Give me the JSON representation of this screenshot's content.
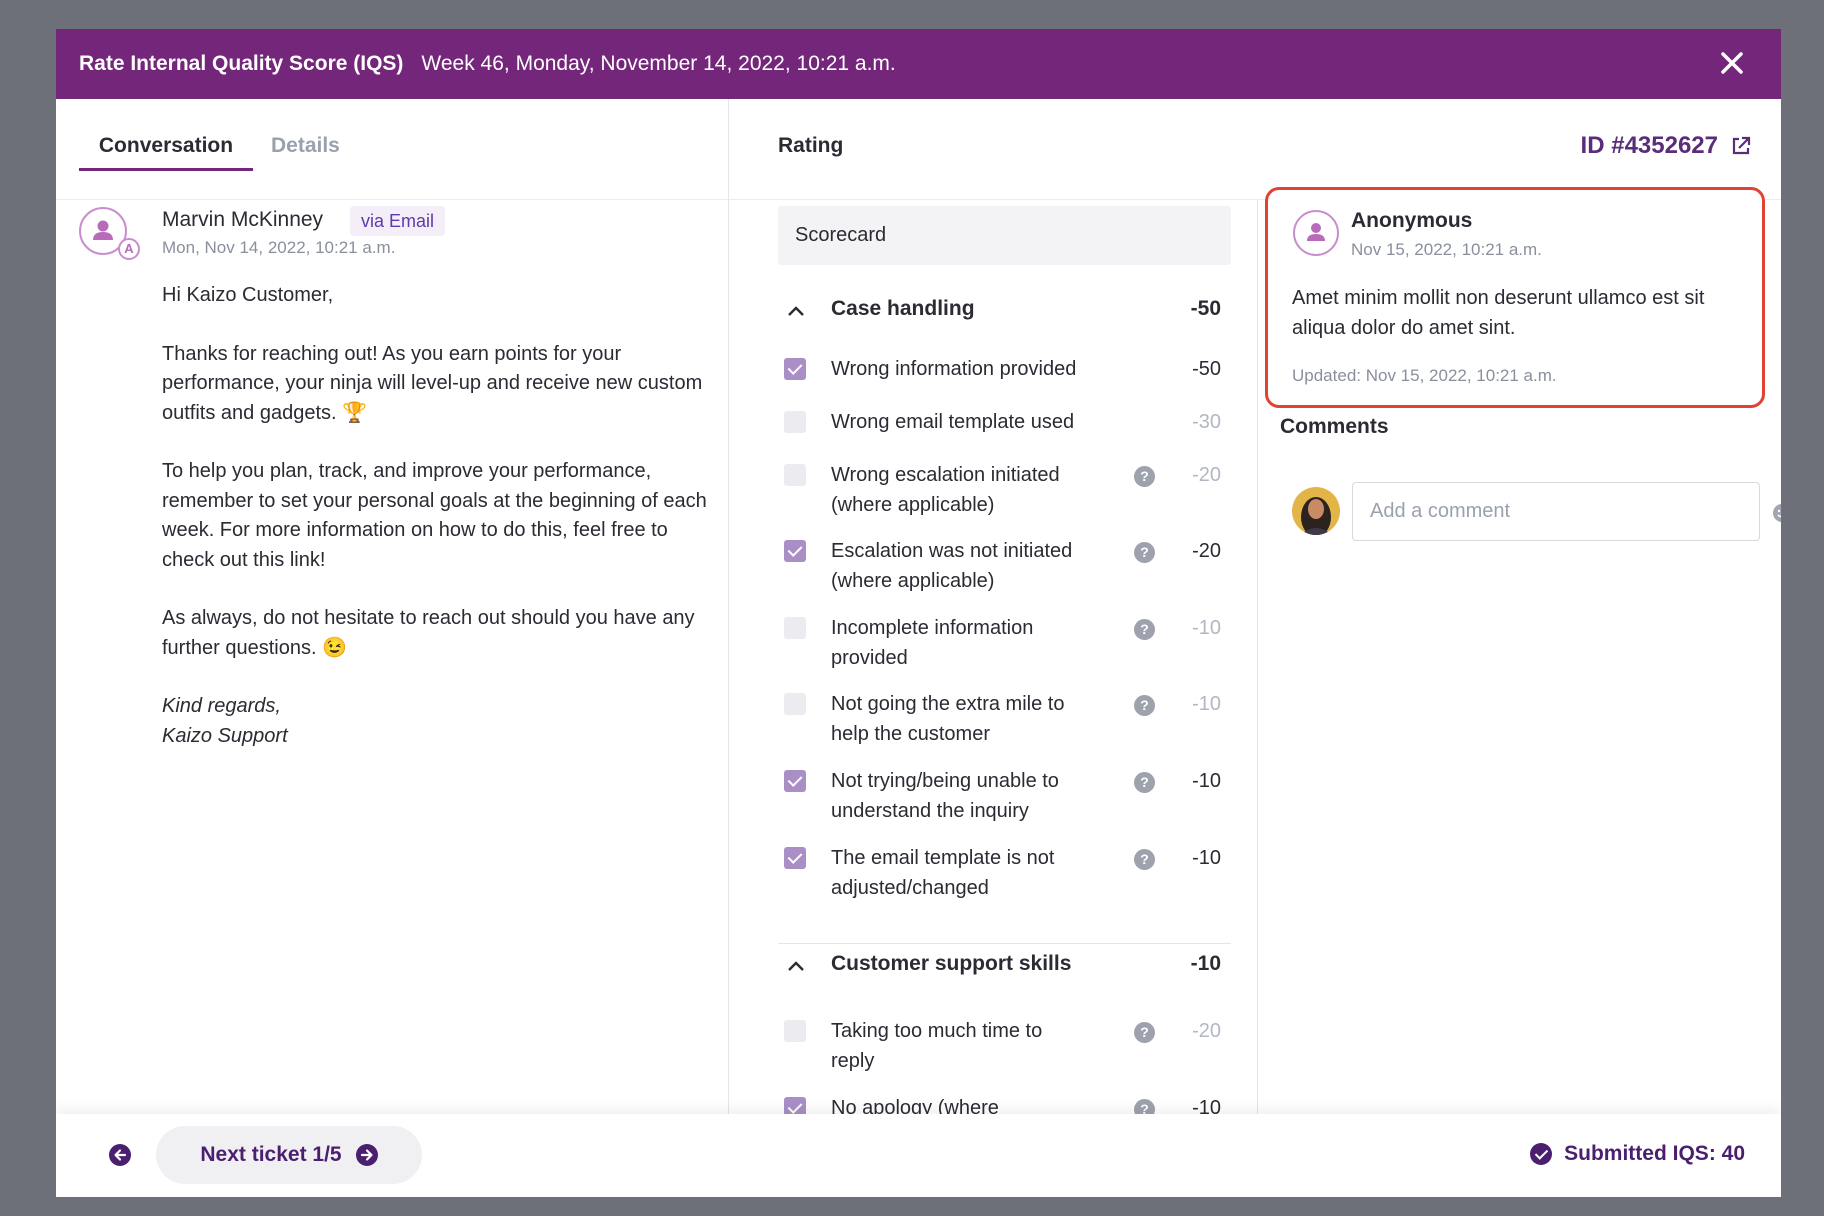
{
  "header": {
    "title": "Rate Internal Quality Score (IQS)",
    "subtitle": "Week 46, Monday, November 14, 2022, 10:21 a.m."
  },
  "tabs": [
    {
      "label": "Conversation",
      "active": true
    },
    {
      "label": "Details",
      "active": false
    }
  ],
  "conversation": {
    "sender": "Marvin McKinney",
    "channel": "via Email",
    "timestamp": "Mon, Nov 14, 2022, 10:21 a.m.",
    "avatar_badge": "A",
    "paragraphs": [
      "Hi Kaizo Customer,",
      "Thanks for reaching out! As you earn points for your performance, your ninja will level-up and receive new custom outfits and gadgets. 🏆",
      "To help you plan, track, and improve your performance, remember to set your personal goals at the beginning of each week. For more information on how to do this, feel free to check out this link!",
      "As always, do not hesitate to reach out should you have any further questions. 😉"
    ],
    "sign_off": "Kind regards,",
    "signature": "Kaizo Support"
  },
  "rating": {
    "label": "Rating",
    "ticket_id": "ID #4352627",
    "scorecard": "Scorecard",
    "sections": [
      {
        "name": "Case handling",
        "total": "-50",
        "criteria": [
          {
            "label": "Wrong information provided",
            "points": "-50",
            "checked": true,
            "help": false
          },
          {
            "label": "Wrong email template used",
            "points": "-30",
            "checked": false,
            "help": false
          },
          {
            "label": "Wrong escalation initiated (where applicable)",
            "points": "-20",
            "checked": false,
            "help": true
          },
          {
            "label": "Escalation was not initiated (where applicable)",
            "points": "-20",
            "checked": true,
            "help": true
          },
          {
            "label": "Incomplete information provided",
            "points": "-10",
            "checked": false,
            "help": true
          },
          {
            "label": "Not going the extra mile to help the customer",
            "points": "-10",
            "checked": false,
            "help": true
          },
          {
            "label": "Not trying/being unable to understand the inquiry",
            "points": "-10",
            "checked": true,
            "help": true
          },
          {
            "label": "The email template is not adjusted/changed",
            "points": "-10",
            "checked": true,
            "help": true
          }
        ]
      },
      {
        "name": "Customer support skills",
        "total": "-10",
        "criteria": [
          {
            "label": "Taking too much time to reply",
            "points": "-20",
            "checked": false,
            "help": true
          },
          {
            "label": "No apology (where",
            "points": "-10",
            "checked": true,
            "help": true
          }
        ]
      }
    ]
  },
  "comment_card": {
    "author": "Anonymous",
    "date": "Nov 15, 2022, 10:21 a.m.",
    "body": "Amet minim mollit non deserunt ullamco est sit aliqua dolor do amet sint.",
    "updated": "Updated: Nov 15, 2022, 10:21 a.m."
  },
  "comments": {
    "heading": "Comments",
    "placeholder": "Add a comment"
  },
  "footer": {
    "next_label": "Next ticket 1/5",
    "submitted": "Submitted IQS: 40"
  },
  "colors": {
    "header_bg": "#74267a",
    "accent_dark": "#4b1f6f",
    "highlight_border": "#e04332",
    "checkbox_on": "#a98fc6"
  },
  "icons": [
    "close-icon",
    "external-link-icon",
    "chevron-up-icon",
    "help-icon",
    "user-icon",
    "emoji-icon",
    "arrow-left-icon",
    "arrow-right-icon",
    "check-circle-icon"
  ]
}
